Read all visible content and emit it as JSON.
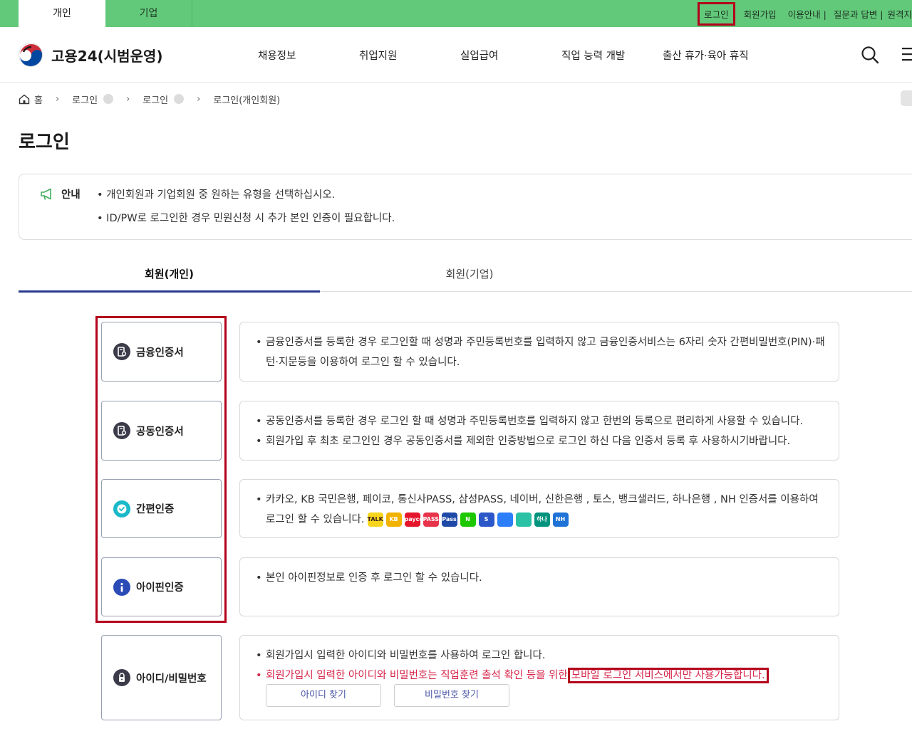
{
  "topbar": {
    "tabs": [
      "개인",
      "기업"
    ],
    "links": {
      "login": "로그인",
      "signup": "회원가입",
      "guide": "이용안내 |",
      "faq": "질문과 답변 |",
      "remote": "원격지"
    }
  },
  "header": {
    "logo_text": "고용24(시범운영)",
    "menu": [
      "채용정보",
      "취업지원",
      "실업급여",
      "직업 능력 개발",
      "출산 휴가·육아 휴직"
    ]
  },
  "breadcrumb": {
    "home": "홈",
    "items": [
      "로그인",
      "로그인",
      "로그인(개인회원)"
    ]
  },
  "page_title": "로그인",
  "notice": {
    "label": "안내",
    "lines": [
      "• 개인회원과 기업회원 중 원하는 유형을 선택하십시오.",
      "• ID/PW로 로그인한 경우 민원신청 시 추가 본인 인증이 필요합니다."
    ]
  },
  "member_tabs": [
    "회원(개인)",
    "회원(기업)"
  ],
  "options": [
    {
      "label": "금융인증서",
      "icon": "certificate-icon",
      "desc": [
        "금융인증서를 등록한 경우 로그인할 때 성명과 주민등록번호를 입력하지 않고 금융인증서비스는 6자리 숫자 간편비밀번호(PIN)·패턴·지문등을 이용하여 로그인 할 수 있습니다."
      ]
    },
    {
      "label": "공동인증서",
      "icon": "certificate-icon",
      "desc": [
        "공동인증서를 등록한 경우 로그인 할 때 성명과 주민등록번호를 입력하지 않고 한번의 등록으로 편리하게 사용할 수 있습니다.",
        "회원가입 후 최초 로그인인 경우 공동인증서를 제외한 인증방법으로 로그인 하신 다음 인증서 등록 후 사용하시기바랍니다."
      ]
    },
    {
      "label": "간편인증",
      "icon": "check-shield-icon",
      "desc": [
        "카카오, KB 국민은행, 페이코, 통신사PASS, 삼성PASS, 네이버, 신한은행 , 토스, 뱅크샐러드, 하나은행 , NH 인증서를 이용하여 로그인 할 수 있습니다."
      ]
    },
    {
      "label": "아이핀인증",
      "icon": "info-icon",
      "desc": [
        "본인 아이핀정보로 인증 후 로그인 할 수 있습니다."
      ]
    },
    {
      "label": "아이디/비밀번호",
      "icon": "lock-icon",
      "desc": [
        "회원가입시 입력한 아이디와 비밀번호를 사용하여 로그인 합니다."
      ],
      "warning_prefix": "회원가입시 입력한 아이디와 비밀번호는 직업훈련 출석 확인 등을 위한",
      "warning_highlight": "모바일 로그인 서비스에서만 사용가능합니다."
    }
  ],
  "find_buttons": {
    "find_id": "아이디 찾기",
    "find_pw": "비밀번호 찾기"
  },
  "easy_auth_icons": [
    {
      "name": "kakao-icon",
      "text": "TALK",
      "color": "#f7d51c"
    },
    {
      "name": "kb-icon",
      "text": "KB",
      "color": "#f2b300"
    },
    {
      "name": "payco-icon",
      "text": "payco",
      "color": "#e5162c"
    },
    {
      "name": "pass-icon",
      "text": "PASS",
      "color": "#e8344a"
    },
    {
      "name": "samsung-pass-icon",
      "text": "Pass",
      "color": "#1f49a6"
    },
    {
      "name": "naver-icon",
      "text": "N",
      "color": "#1ec800"
    },
    {
      "name": "shinhan-icon",
      "text": "S",
      "color": "#2b57c8"
    },
    {
      "name": "toss-icon",
      "text": "",
      "color": "#2d7ff9"
    },
    {
      "name": "banksalad-icon",
      "text": "",
      "color": "#2ac1a4"
    },
    {
      "name": "hana-icon",
      "text": "하나",
      "color": "#00947e"
    },
    {
      "name": "nh-icon",
      "text": "NH",
      "color": "#1f73d6"
    }
  ],
  "colors": {
    "topbar": "#63c97a",
    "accent": "#2a3a8f",
    "warning": "#d6264a",
    "highlight_frame": "#b3001b"
  }
}
